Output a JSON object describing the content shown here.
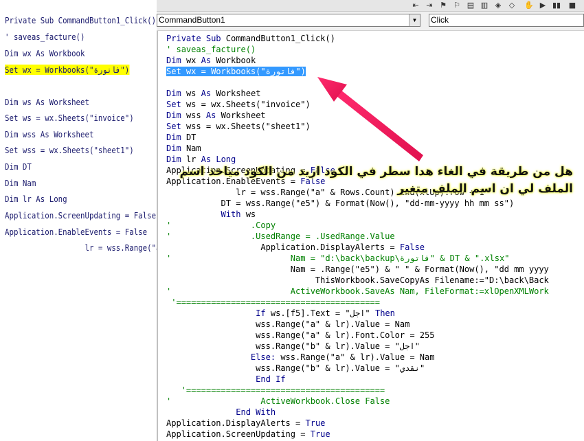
{
  "left_snippet": {
    "lines": [
      {
        "text": "Private Sub CommandButton1_Click()"
      },
      {
        "text": "' saveas_facture()"
      },
      {
        "text": "Dim wx As Workbook"
      },
      {
        "text": "Set wx = Workbooks(\"فاتورة\")",
        "highlight": true
      },
      {
        "text": ""
      },
      {
        "text": "Dim ws As Worksheet"
      },
      {
        "text": "Set ws = wx.Sheets(\"invoice\")"
      },
      {
        "text": "Dim wss As Worksheet"
      },
      {
        "text": "Set wss = wx.Sheets(\"sheet1\")"
      },
      {
        "text": "Dim DT"
      },
      {
        "text": "Dim Nam"
      },
      {
        "text": "Dim lr As Long"
      },
      {
        "text": "Application.ScreenUpdating = False"
      },
      {
        "text": "Application.EnableEvents = False"
      },
      {
        "text": "                  lr = wss.Range(\"a\" & Rows"
      }
    ]
  },
  "dropdowns": {
    "object": "CommandButton1",
    "procedure": "Click"
  },
  "code_lines": [
    {
      "tokens": [
        [
          "kw",
          "Private Sub "
        ],
        [
          "n",
          "CommandButton1_Click()"
        ]
      ]
    },
    {
      "tokens": [
        [
          "cmt",
          "' saveas_facture()"
        ]
      ]
    },
    {
      "tokens": [
        [
          "kw",
          "Dim "
        ],
        [
          "n",
          "wx "
        ],
        [
          "kw",
          "As "
        ],
        [
          "n",
          "Workbook"
        ]
      ]
    },
    {
      "tokens": [
        [
          "sel",
          "Set wx = Workbooks(\"فاتورة\")"
        ]
      ]
    },
    {
      "tokens": [
        [
          "n",
          ""
        ]
      ]
    },
    {
      "tokens": [
        [
          "kw",
          "Dim "
        ],
        [
          "n",
          "ws "
        ],
        [
          "kw",
          "As "
        ],
        [
          "n",
          "Worksheet"
        ]
      ]
    },
    {
      "tokens": [
        [
          "kw",
          "Set "
        ],
        [
          "n",
          "ws = wx.Sheets(\"invoice\")"
        ]
      ]
    },
    {
      "tokens": [
        [
          "kw",
          "Dim "
        ],
        [
          "n",
          "wss "
        ],
        [
          "kw",
          "As "
        ],
        [
          "n",
          "Worksheet"
        ]
      ]
    },
    {
      "tokens": [
        [
          "kw",
          "Set "
        ],
        [
          "n",
          "wss = wx.Sheets(\"sheet1\")"
        ]
      ]
    },
    {
      "tokens": [
        [
          "kw",
          "Dim "
        ],
        [
          "n",
          "DT"
        ]
      ]
    },
    {
      "tokens": [
        [
          "kw",
          "Dim "
        ],
        [
          "n",
          "Nam"
        ]
      ]
    },
    {
      "tokens": [
        [
          "kw",
          "Dim "
        ],
        [
          "n",
          "lr "
        ],
        [
          "kw",
          "As Long"
        ]
      ]
    },
    {
      "tokens": [
        [
          "n",
          "Application.ScreenUpdating = "
        ],
        [
          "kw",
          "False"
        ]
      ]
    },
    {
      "tokens": [
        [
          "n",
          "Application.EnableEvents = "
        ],
        [
          "kw",
          "False"
        ]
      ]
    },
    {
      "tokens": [
        [
          "n",
          "              lr = wss.Range(\"a\" & Rows.Count).End(xlUp).row + 1"
        ]
      ]
    },
    {
      "tokens": [
        [
          "n",
          "           DT = wss.Range(\"e5\") & Format(Now(), \"dd-mm-yyyy hh mm ss\")"
        ]
      ]
    },
    {
      "tokens": [
        [
          "kw",
          "           With "
        ],
        [
          "n",
          "ws"
        ]
      ]
    },
    {
      "tokens": [
        [
          "cmt",
          "'                .Copy"
        ]
      ]
    },
    {
      "tokens": [
        [
          "cmt",
          "'                .UsedRange = .UsedRange.Value"
        ]
      ]
    },
    {
      "tokens": [
        [
          "n",
          "                   Application.DisplayAlerts = "
        ],
        [
          "kw",
          "False"
        ]
      ]
    },
    {
      "tokens": [
        [
          "cmt",
          "'                        Nam = \"d:\\back\\backup\\فاتورة\" & DT & \".xlsx\""
        ]
      ]
    },
    {
      "tokens": [
        [
          "n",
          "                         Nam = .Range(\"e5\") & \" \" & Format(Now(), \"dd mm yyyy"
        ]
      ]
    },
    {
      "tokens": [
        [
          "n",
          "                              ThisWorkbook.SaveCopyAs Filename:=\"D:\\back\\Back"
        ]
      ]
    },
    {
      "tokens": [
        [
          "cmt",
          "'                        ActiveWorkbook.SaveAs Nam, FileFormat:=xlOpenXMLWork"
        ]
      ]
    },
    {
      "tokens": [
        [
          "cmt",
          " '========================================="
        ]
      ]
    },
    {
      "tokens": [
        [
          "kw",
          "                  If "
        ],
        [
          "n",
          "ws.[f5].Text = \"اجل\" "
        ],
        [
          "kw",
          "Then"
        ]
      ]
    },
    {
      "tokens": [
        [
          "n",
          "                  wss.Range(\"a\" & lr).Value = Nam"
        ]
      ]
    },
    {
      "tokens": [
        [
          "n",
          "                  wss.Range(\"a\" & lr).Font.Color = 255"
        ]
      ]
    },
    {
      "tokens": [
        [
          "n",
          "                  wss.Range(\"b\" & lr).Value = \"اجل\""
        ]
      ]
    },
    {
      "tokens": [
        [
          "kw",
          "                 Else: "
        ],
        [
          "n",
          "wss.Range(\"a\" & lr).Value = Nam"
        ]
      ]
    },
    {
      "tokens": [
        [
          "n",
          "                  wss.Range(\"b\" & lr).Value = \"نقدي\""
        ]
      ]
    },
    {
      "tokens": [
        [
          "kw",
          "                  End If"
        ]
      ]
    },
    {
      "tokens": [
        [
          "cmt",
          "   '========================================"
        ]
      ]
    },
    {
      "tokens": [
        [
          "cmt",
          "'                  ActiveWorkbook.Close False"
        ]
      ]
    },
    {
      "tokens": [
        [
          "kw",
          "              End With"
        ]
      ]
    },
    {
      "tokens": [
        [
          "n",
          "Application.DisplayAlerts = "
        ],
        [
          "kw",
          "True"
        ]
      ]
    },
    {
      "tokens": [
        [
          "n",
          "Application.ScreenUpdating = "
        ],
        [
          "kw",
          "True"
        ]
      ]
    }
  ],
  "question": "هل من طريقة في الغاء هدا سطر في الكود اريد من الكود مياخذ اسم الملف لي ان اسم الملف متغير",
  "colors": {
    "keyword": "#00008b",
    "comment": "#008000",
    "selection": "#3399ff",
    "highlight": "#ffff00",
    "arrow": "#ff2a6d"
  }
}
